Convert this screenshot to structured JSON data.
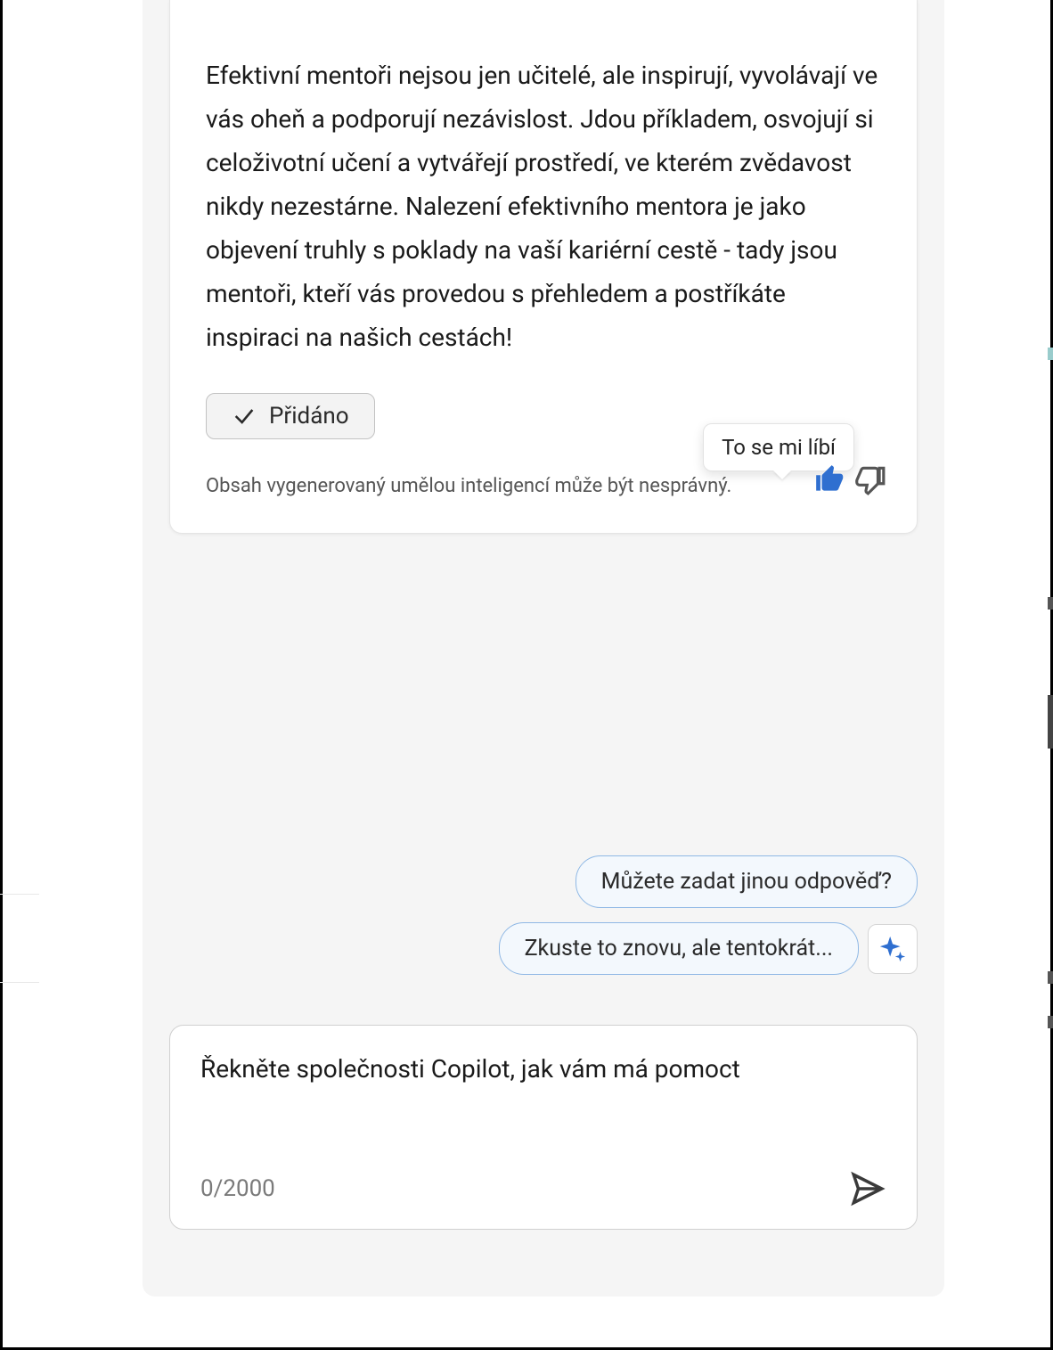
{
  "response": {
    "text": "Efektivní mentoři nejsou jen učitelé, ale inspirují, vyvolávají ve vás oheň a podporují nezávislost. Jdou příkladem, osvojují si celoživotní učení a vytvářejí prostředí, ve kterém zvědavost nikdy nezestárne. Nalezení efektivního mentora je jako objevení truhly s poklady na vaší kariérní cestě - tady jsou mentoři, kteří vás provedou s přehledem a postříkáte inspiraci na našich cestách!",
    "added_label": "Přidáno",
    "disclaimer": "Obsah vygenerovaný umělou inteligencí může být nesprávný.",
    "tooltip_like": "To se mi líbí"
  },
  "suggestions": {
    "s1": "Můžete zadat jinou odpověď?",
    "s2": "Zkuste to znovu, ale tentokrát..."
  },
  "input": {
    "placeholder": "Řekněte společnosti Copilot, jak vám má pomoct",
    "counter": "0/2000"
  }
}
